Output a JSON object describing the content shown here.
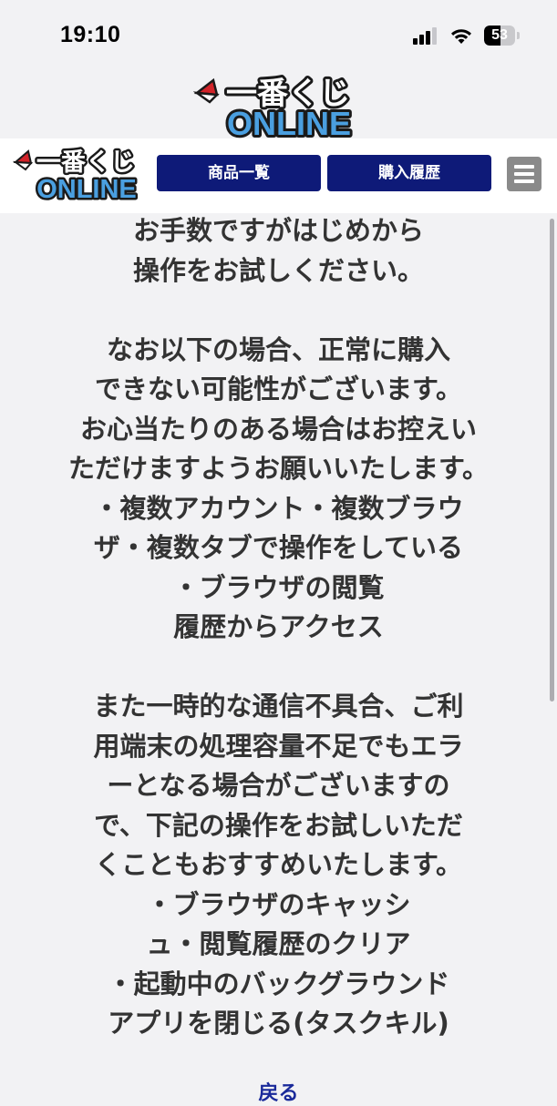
{
  "status_bar": {
    "time": "19:10",
    "battery": "53",
    "battery_level": 0.53
  },
  "header": {
    "logo_top": "一番くじ",
    "logo_bottom": "ONLINE",
    "nav_products": "商品一覧",
    "nav_history": "購入履歴"
  },
  "message": {
    "lines_1": [
      "お手数ですがはじめから",
      "操作をお試しください。"
    ],
    "lines_2": [
      "なお以下の場合、正常に購入",
      "できない可能性がございます。",
      "お心当たりのある場合はお控えい",
      "ただけますようお願いいたします。",
      "・複数アカウント・複数ブラウ",
      "ザ・複数タブで操作をしている",
      "・ブラウザの閲覧",
      "履歴からアクセス"
    ],
    "lines_3": [
      "また一時的な通信不具合、ご利",
      "用端末の処理容量不足でもエラ",
      "ーとなる場合がございますの",
      "で、下記の操作をお試しいただ",
      "くこともおすすめいたします。",
      "・ブラウザのキャッシ",
      "ュ・閲覧履歴のクリア",
      "・起動中のバックグラウンド",
      "アプリを閉じる(タスクキル)"
    ]
  },
  "back_link": "戻る",
  "colors": {
    "nav_button": "#0e1a78",
    "logo_blue": "#4a9fe0",
    "logo_red": "#d2242a"
  }
}
